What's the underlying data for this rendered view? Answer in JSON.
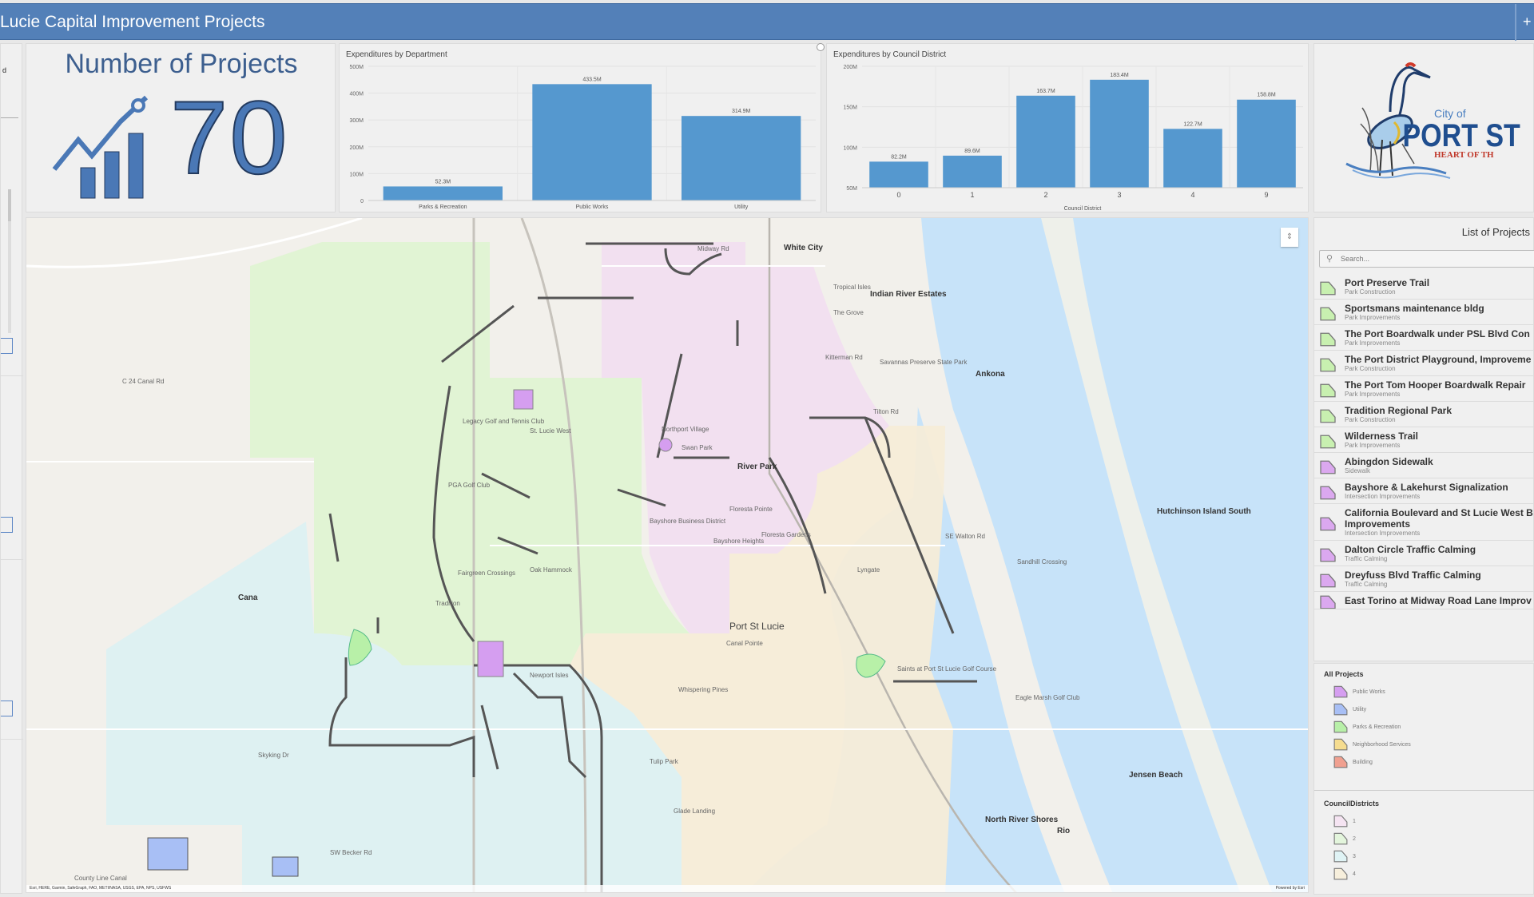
{
  "header": {
    "title": "Lucie Capital Improvement Projects",
    "menu_icon": "plus-icon"
  },
  "left_panel": {
    "text_fragment": "d"
  },
  "project_count": {
    "title": "Number of Projects",
    "value": "70",
    "icon": "trend-chart-icon"
  },
  "chart_data": [
    {
      "type": "bar",
      "title": "Expenditures by Department",
      "categories": [
        "Parks & Recreation",
        "Public Works",
        "Utility"
      ],
      "values": [
        52.3,
        433.5,
        314.9
      ],
      "value_labels": [
        "52.3M",
        "433.5M",
        "314.9M"
      ],
      "yticks": [
        "0",
        "100M",
        "200M",
        "300M",
        "400M",
        "500M"
      ],
      "ylim": [
        0,
        500
      ],
      "unit": "M",
      "xlabel": "",
      "ylabel": "",
      "grid": true,
      "bar_color": "#5598cf"
    },
    {
      "type": "bar",
      "title": "Expenditures by Council District",
      "categories": [
        "0",
        "1",
        "2",
        "3",
        "4",
        "9"
      ],
      "values": [
        82.2,
        89.6,
        163.7,
        183.4,
        122.7,
        158.8
      ],
      "value_labels": [
        "82.2M",
        "89.6M",
        "163.7M",
        "183.4M",
        "122.7M",
        "158.8M"
      ],
      "yticks": [
        "50M",
        "100M",
        "150M",
        "200M"
      ],
      "ylim": [
        50,
        200
      ],
      "unit": "M",
      "xlabel": "Council District",
      "ylabel": "",
      "grid": true,
      "bar_color": "#5598cf"
    }
  ],
  "logo": {
    "small_text": "City of",
    "big_text": "PORT ST",
    "tagline": "HEART OF TH"
  },
  "map": {
    "labels": [
      {
        "text": "White City",
        "kind": "city"
      },
      {
        "text": "Indian River Estates",
        "kind": "city"
      },
      {
        "text": "Ankona",
        "kind": "city"
      },
      {
        "text": "River Park",
        "kind": "city"
      },
      {
        "text": "Port St Lucie",
        "kind": "big"
      },
      {
        "text": "Jensen Beach",
        "kind": "city"
      },
      {
        "text": "North River Shores",
        "kind": "city"
      },
      {
        "text": "Rio",
        "kind": "city"
      },
      {
        "text": "Hutchinson Island South",
        "kind": "city"
      },
      {
        "text": "Cana",
        "kind": "city"
      },
      {
        "text": "Tradition",
        "kind": "minor"
      },
      {
        "text": "Northport Village",
        "kind": "minor"
      },
      {
        "text": "Swan Park",
        "kind": "minor"
      },
      {
        "text": "Floresta Pointe",
        "kind": "minor"
      },
      {
        "text": "Bayshore Heights",
        "kind": "minor"
      },
      {
        "text": "Floresta Gardens",
        "kind": "minor"
      },
      {
        "text": "Bayshore Business District",
        "kind": "minor"
      },
      {
        "text": "Canal Pointe",
        "kind": "minor"
      },
      {
        "text": "Lyngate",
        "kind": "minor"
      },
      {
        "text": "Sandhill Crossing",
        "kind": "minor"
      },
      {
        "text": "Savannas Preserve State Park",
        "kind": "minor"
      },
      {
        "text": "Tropical Isles",
        "kind": "minor"
      },
      {
        "text": "The Grove",
        "kind": "minor"
      },
      {
        "text": "St. Lucie West",
        "kind": "minor"
      },
      {
        "text": "PGA Golf Club",
        "kind": "minor"
      },
      {
        "text": "Legacy Golf and Tennis Club",
        "kind": "minor"
      },
      {
        "text": "Saints at Port St Lucie Golf Course",
        "kind": "minor"
      },
      {
        "text": "Eagle Marsh Golf Club",
        "kind": "minor"
      },
      {
        "text": "Fairgreen Crossings",
        "kind": "minor"
      },
      {
        "text": "Oak Hammock",
        "kind": "minor"
      },
      {
        "text": "Newport Isles",
        "kind": "minor"
      },
      {
        "text": "Whispering Pines",
        "kind": "minor"
      },
      {
        "text": "Tulip Park",
        "kind": "minor"
      },
      {
        "text": "Glade Landing",
        "kind": "minor"
      },
      {
        "text": "C 24 Canal Rd",
        "kind": "minor"
      },
      {
        "text": "Midway Rd",
        "kind": "minor"
      },
      {
        "text": "Kitterman Rd",
        "kind": "minor"
      },
      {
        "text": "Tilton Rd",
        "kind": "minor"
      },
      {
        "text": "SE Walton Rd",
        "kind": "minor"
      },
      {
        "text": "SW Becker Rd",
        "kind": "minor"
      },
      {
        "text": "Skyking Dr",
        "kind": "minor"
      },
      {
        "text": "County Line Canal",
        "kind": "minor"
      }
    ],
    "control_icon": "expand-icon",
    "attribution": "Esri, HERE, Garmin, SafeGraph, FAO, METI/NASA, USGS, EPA, NPS, USFWS",
    "powered_by": "Powered by Esri"
  },
  "project_list": {
    "title": "List of Projects",
    "search_placeholder": "Search...",
    "items": [
      {
        "name": "Port Preserve Trail",
        "type": "Park Construction",
        "color": "#c8f0b0"
      },
      {
        "name": "Sportsmans maintenance bldg",
        "type": "Park Improvements",
        "color": "#c8f0b0"
      },
      {
        "name": "The Port Boardwalk under PSL Blvd Con",
        "type": "Park Improvements",
        "color": "#c8f0b0"
      },
      {
        "name": "The Port District Playground, Improveme Project",
        "type": "Park Construction",
        "color": "#c8f0b0"
      },
      {
        "name": "The Port Tom Hooper Boardwalk Repair",
        "type": "Park Improvements",
        "color": "#c8f0b0"
      },
      {
        "name": "Tradition Regional Park",
        "type": "Park Construction",
        "color": "#c8f0b0"
      },
      {
        "name": "Wilderness Trail",
        "type": "Park Improvements",
        "color": "#c8f0b0"
      },
      {
        "name": "Abingdon Sidewalk",
        "type": "Sidewalk",
        "color": "#dba8ef"
      },
      {
        "name": "Bayshore & Lakehurst Signalization",
        "type": "Intersection Improvements",
        "color": "#dba8ef"
      },
      {
        "name": "California Boulevard and St Lucie West B Improvements",
        "type": "Intersection Improvements",
        "color": "#dba8ef"
      },
      {
        "name": "Dalton Circle Traffic Calming",
        "type": "Traffic Calming",
        "color": "#dba8ef"
      },
      {
        "name": "Dreyfuss Blvd Traffic Calming",
        "type": "Traffic Calming",
        "color": "#dba8ef"
      },
      {
        "name": "East Torino at Midway Road Lane Improv",
        "type": "",
        "color": "#dba8ef"
      }
    ]
  },
  "legend": {
    "all_projects": {
      "title": "All Projects",
      "items": [
        {
          "label": "Public Works",
          "color": "#d59ef0"
        },
        {
          "label": "Utility",
          "color": "#a8bff5"
        },
        {
          "label": "Parks & Recreation",
          "color": "#b8f0a8"
        },
        {
          "label": "Neighborhood Services",
          "color": "#f5dc8f"
        },
        {
          "label": "Building",
          "color": "#f0a090"
        }
      ]
    },
    "council_districts": {
      "title": "CouncilDistricts",
      "items": [
        {
          "label": "1",
          "color": "#f5e4f2"
        },
        {
          "label": "2",
          "color": "#e3f5dc"
        },
        {
          "label": "3",
          "color": "#dff3f5"
        },
        {
          "label": "4",
          "color": "#f7efdc"
        }
      ]
    }
  }
}
